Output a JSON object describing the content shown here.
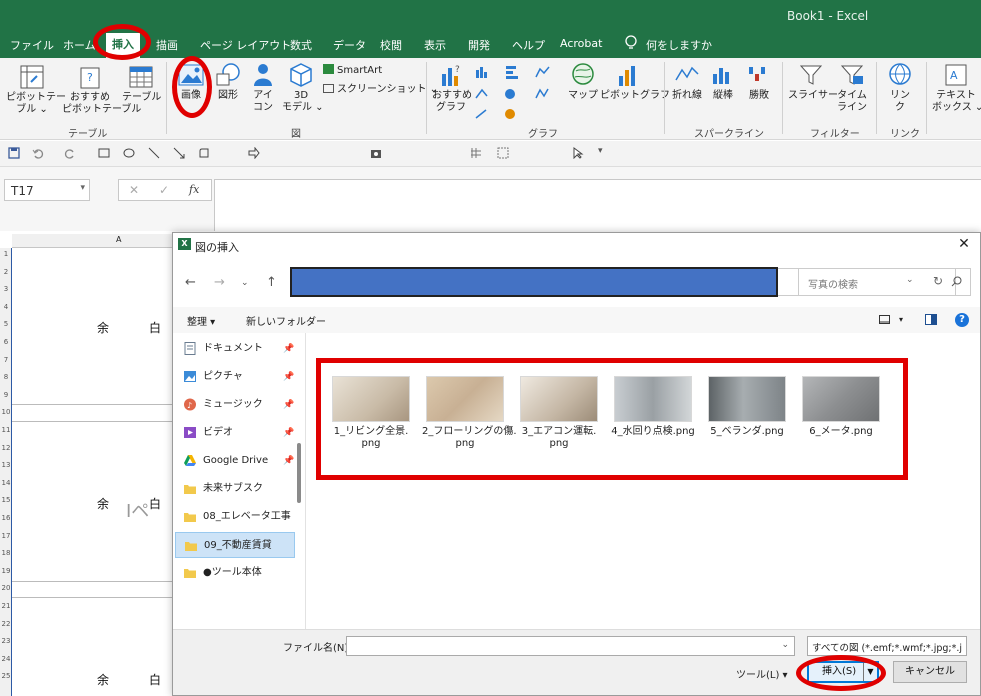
{
  "app": {
    "title": "Book1  -  Excel",
    "tabs": [
      "ファイル",
      "ホーム",
      "挿入",
      "描画",
      "ページ レイアウト",
      "数式",
      "データ",
      "校閲",
      "表示",
      "開発",
      "ヘルプ",
      "Acrobat",
      "何をしますか"
    ],
    "active_tab": "挿入"
  },
  "ribbon": {
    "pivot_table": "ピボットテー\nブル ⌄",
    "recommended_pivot": "おすすめ\nピボットテーブル",
    "table": "テーブル",
    "group_table": "テーブル",
    "image": "画像",
    "shapes": "図形",
    "icons": "アイ\nコン",
    "models_3d": "3D\nモデル ⌄",
    "smartart": "SmartArt",
    "screenshot": "スクリーンショット ⌄",
    "group_figure": "図",
    "recommended_chart": "おすすめ\nグラフ",
    "map": "マップ",
    "pivot_chart": "ピボットグラフ",
    "group_chart": "グラフ",
    "line": "折れ線",
    "column": "縦棒",
    "winloss": "勝敗",
    "group_sparkline": "スパークライン",
    "slicer": "スライサー",
    "timeline": "タイム\nライン",
    "group_filter": "フィルター",
    "link": "リン\nク",
    "group_link": "リンク",
    "textbox": "テキスト\nボックス ⌄"
  },
  "formula_bar": {
    "name_box": "T17",
    "cancel": "✕",
    "confirm": "✓",
    "fx": "fx"
  },
  "sheet": {
    "column_header": "A",
    "row_numbers": [
      "1",
      "2",
      "3",
      "4",
      "5",
      "6",
      "7",
      "8",
      "9",
      "10",
      "11",
      "12",
      "13",
      "14",
      "15",
      "16",
      "17",
      "18",
      "19",
      "20",
      "21",
      "22",
      "23",
      "24",
      "25"
    ],
    "cells": [
      "余　白",
      "余　白",
      "余　白"
    ],
    "cursor_text": "Iペ"
  },
  "dialog": {
    "title": "図の挿入",
    "search_placeholder": "写真の検索",
    "organize": "整理 ▾",
    "new_folder": "新しいフォルダー",
    "nav_items": [
      {
        "label": "ドキュメント",
        "icon": "document-icon",
        "pinned": true
      },
      {
        "label": "ピクチャ",
        "icon": "pictures-icon",
        "pinned": true
      },
      {
        "label": "ミュージック",
        "icon": "music-icon",
        "pinned": true
      },
      {
        "label": "ビデオ",
        "icon": "video-icon",
        "pinned": true
      },
      {
        "label": "Google Drive",
        "icon": "google-drive-icon",
        "pinned": true
      },
      {
        "label": "未来サブスク",
        "icon": "folder-icon",
        "pinned": false
      },
      {
        "label": "08_エレベータ工事",
        "icon": "folder-icon",
        "pinned": false
      },
      {
        "label": "09_不動産賃貸",
        "icon": "folder-icon",
        "pinned": false,
        "selected": true
      },
      {
        "label": "●ツール本体",
        "icon": "folder-icon",
        "pinned": false
      }
    ],
    "files": [
      {
        "name": "1_リビング全景.\npng",
        "color": "#c9bba7"
      },
      {
        "name": "2_フローリングの傷.\npng",
        "color": "#c8b094"
      },
      {
        "name": "3_エアコン運転.\npng",
        "color": "#c4b6a4"
      },
      {
        "name": "4_水回り点検.png",
        "color": "#9aa0a4"
      },
      {
        "name": "5_ベランダ.png",
        "color": "#7e8488"
      },
      {
        "name": "6_メータ.png",
        "color": "#8d8f91"
      }
    ],
    "filename_label": "ファイル名(N):",
    "filename_value": "",
    "filter": "すべての図 (*.emf;*.wmf;*.jpg;*.j",
    "tools": "ツール(L)  ▾",
    "insert": "挿入(S)",
    "cancel": "キャンセル"
  },
  "colors": {
    "excel_green": "#217346",
    "annotation_red": "#e00000",
    "path_blue": "#4472c4",
    "selection_blue": "#cde3f7"
  }
}
